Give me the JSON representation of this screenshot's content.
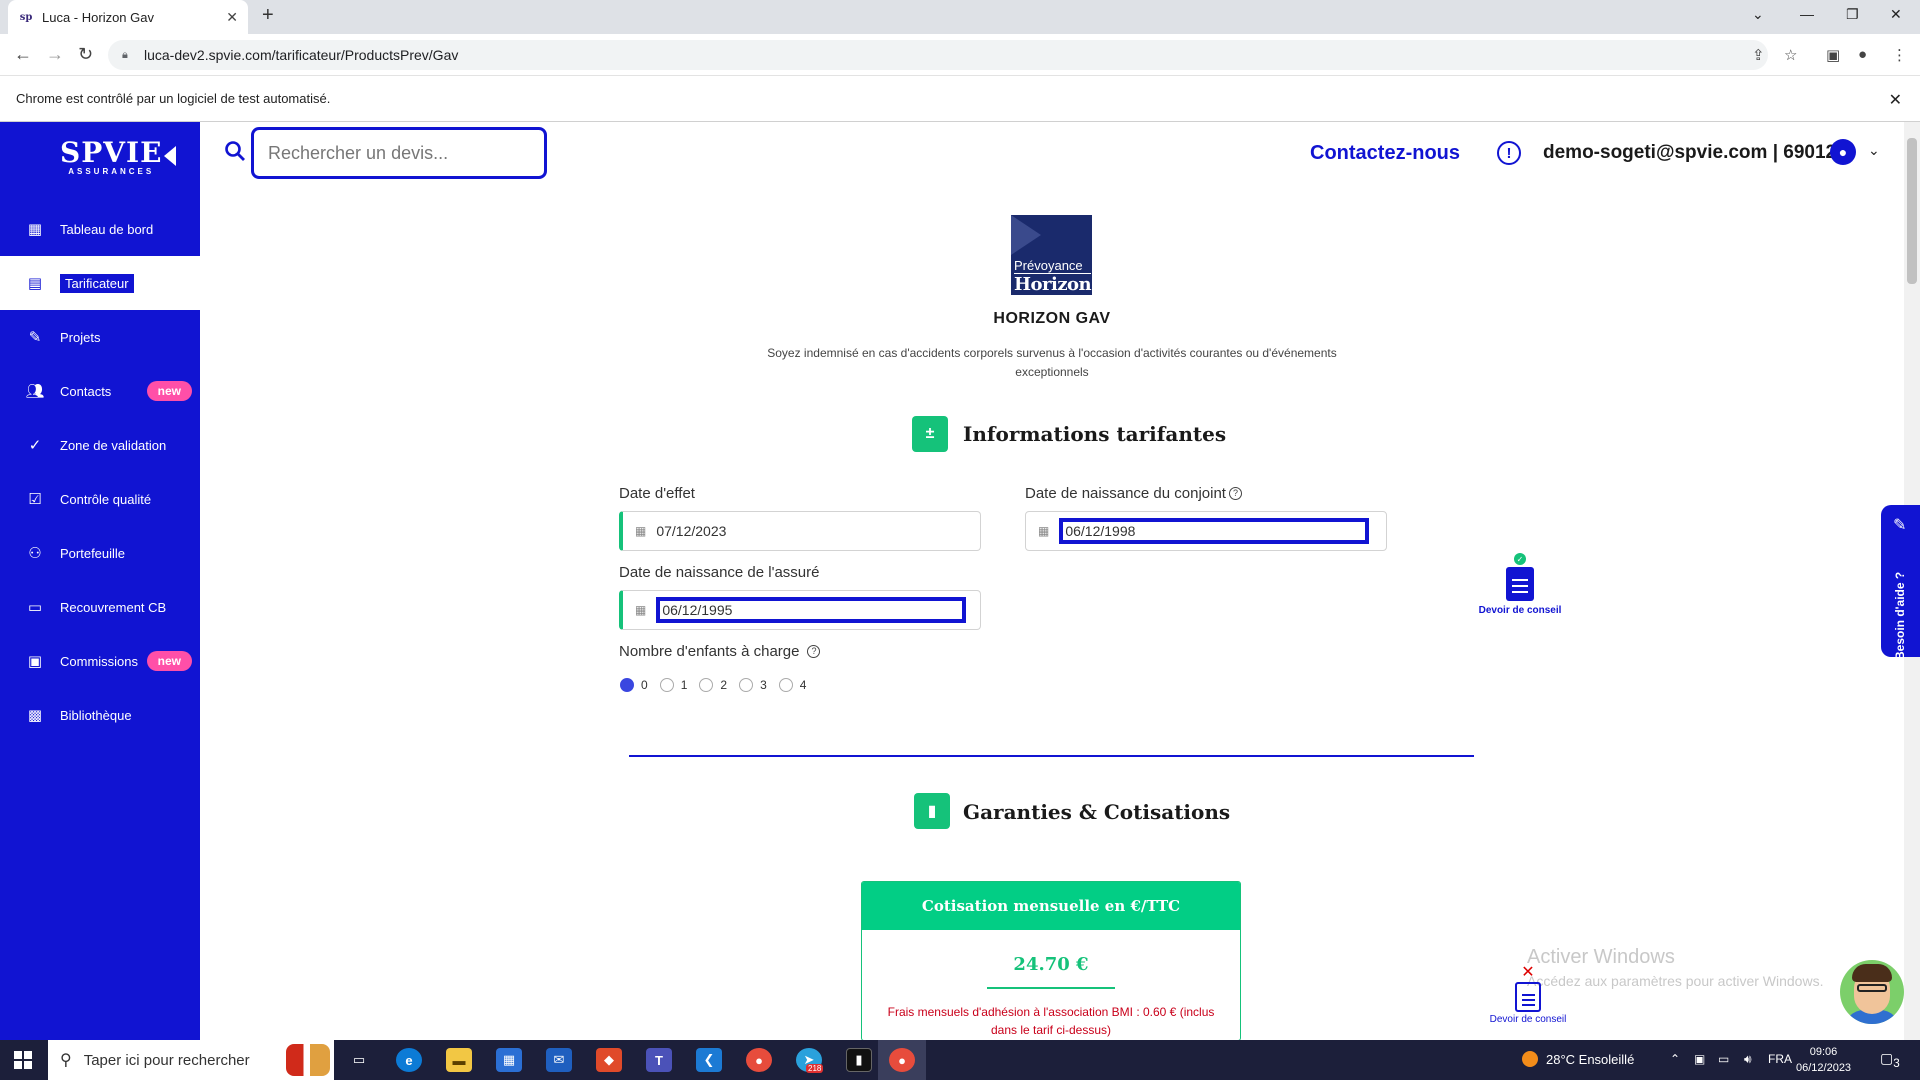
{
  "browser": {
    "tab_title": "Luca - Horizon Gav",
    "tab_favicon_text": "sp",
    "url": "luca-dev2.spvie.com/tarificateur/ProductsPrev/Gav",
    "infobar_text": "Chrome est contrôlé par un logiciel de test automatisé."
  },
  "sidebar": {
    "logo_main": "SPVIE",
    "logo_sub": "ASSURANCES",
    "items": [
      {
        "label": "Tableau de bord",
        "icon": "dashboard-icon"
      },
      {
        "label": "Tarificateur",
        "icon": "calculator-icon",
        "active": true
      },
      {
        "label": "Projets",
        "icon": "pencil-icon"
      },
      {
        "label": "Contacts",
        "icon": "people-icon",
        "badge": "new"
      },
      {
        "label": "Zone de validation",
        "icon": "check-icon"
      },
      {
        "label": "Contrôle qualité",
        "icon": "checklist-icon"
      },
      {
        "label": "Portefeuille",
        "icon": "group-icon"
      },
      {
        "label": "Recouvrement CB",
        "icon": "credit-card-icon"
      },
      {
        "label": "Commissions",
        "icon": "briefcase-icon",
        "badge": "new"
      },
      {
        "label": "Bibliothèque",
        "icon": "library-icon"
      }
    ]
  },
  "header": {
    "search_placeholder": "Rechercher un devis...",
    "contact": "Contactez-nous",
    "user": "demo-sogeti@spvie.com | 69012"
  },
  "product": {
    "logo_line1": "Prévoyance",
    "logo_line2": "Horizon",
    "title": "HORIZON GAV",
    "description": "Soyez indemnisé en cas d'accidents corporels survenus à l'occasion d'activités courantes ou d'événements exceptionnels"
  },
  "tarif": {
    "section_title": "Informations tarifantes",
    "date_effet_label": "Date d'effet",
    "date_effet_value": "07/12/2023",
    "naissance_assure_label": "Date de naissance de l'assuré",
    "naissance_assure_value": "06/12/1995",
    "naissance_conjoint_label": "Date de naissance du conjoint",
    "naissance_conjoint_value": "06/12/1998",
    "enfants_label": "Nombre d'enfants à charge",
    "enfants_options": [
      "0",
      "1",
      "2",
      "3",
      "4"
    ],
    "enfants_selected": "0"
  },
  "devoir_conseil": "Devoir de conseil",
  "help_tab": "Besoin d'aide ?",
  "garanties": {
    "section_title": "Garanties & Cotisations",
    "cotis_header": "Cotisation mensuelle en €/TTC",
    "price": "24.70 €",
    "note": "Frais mensuels d'adhésion à l'association BMI : 0.60 € (inclus dans le tarif ci-dessus)"
  },
  "windows_watermark": {
    "line1": "Activer Windows",
    "line2": "Accédez aux paramètres pour activer Windows."
  },
  "taskbar": {
    "search_placeholder": "Taper ici pour rechercher",
    "weather": "28°C  Ensoleillé",
    "lang": "FRA",
    "time": "09:06",
    "date": "06/12/2023",
    "notif_count": "3",
    "telegram_badge": "218"
  },
  "colors": {
    "brand_blue": "#1114d2",
    "green": "#02ce85",
    "badge_pink": "#ff4fa8"
  }
}
